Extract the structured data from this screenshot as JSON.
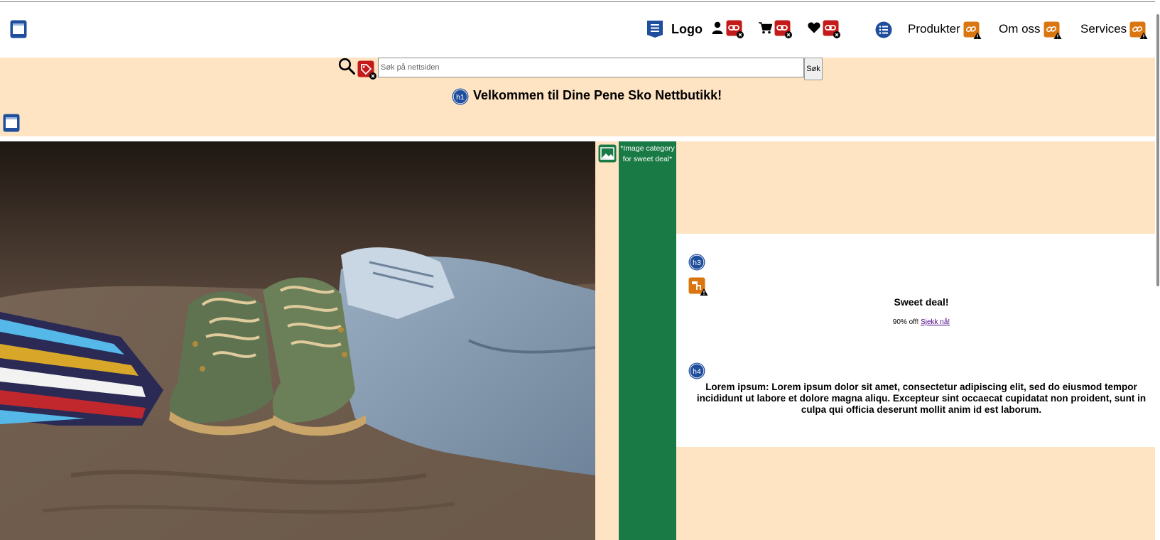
{
  "header": {
    "logo_text": "Logo",
    "nav": [
      {
        "label": "Produkter"
      },
      {
        "label": "Om oss"
      },
      {
        "label": "Services"
      }
    ]
  },
  "search": {
    "placeholder": "Søk på nettsiden",
    "button_label": "Søk"
  },
  "welcome": {
    "heading": "Velkommen til Dine Pene Sko Nettbutikk!"
  },
  "sweet_deal": {
    "image_alt_text": "*Image category for sweet deal*",
    "title": "Sweet deal!",
    "offer_text": "90% off! ",
    "offer_link": "Sjekk nå!"
  },
  "lorem": {
    "text": "Lorem ipsum: Lorem ipsum dolor sit amet, consectetur adipiscing elit, sed do eiusmod tempor incididunt ut labore et dolore magna aliqu. Excepteur sint occaecat cupidatat non proident, sunt in culpa qui officia deserunt mollit anim id est laborum."
  },
  "badges": {
    "h1": "h1",
    "h3": "h3",
    "h4": "h4"
  },
  "colors": {
    "peach": "#ffe4c4",
    "green": "#1a7a45",
    "badge_blue": "#1f4f9c",
    "badge_red": "#c41a1a",
    "badge_orange": "#d9760f"
  },
  "icons": [
    "landmark-icon",
    "user-icon",
    "cart-icon",
    "heart-icon",
    "search-icon",
    "list-icon",
    "broken-link-icon",
    "link-warning-icon",
    "image-icon"
  ]
}
